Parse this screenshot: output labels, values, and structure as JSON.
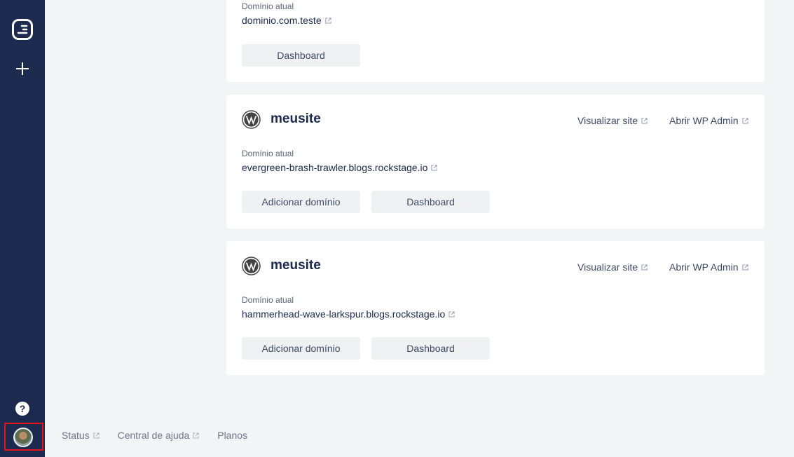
{
  "sidebar": {
    "logo_icon": "brand-logo-icon",
    "add_icon": "plus-icon",
    "help_label": "?",
    "avatar_icon": "user-avatar"
  },
  "cards": [
    {
      "domain_label": "Domínio atual",
      "domain_value": "dominio.com.teste",
      "dashboard_label": "Dashboard"
    },
    {
      "site_name": "meusite",
      "view_site": "Visualizar site",
      "open_admin": "Abrir WP Admin",
      "domain_label": "Domínio atual",
      "domain_value": "evergreen-brash-trawler.blogs.rockstage.io",
      "add_domain": "Adicionar domínio",
      "dashboard_label": "Dashboard"
    },
    {
      "site_name": "meusite",
      "view_site": "Visualizar site",
      "open_admin": "Abrir WP Admin",
      "domain_label": "Domínio atual",
      "domain_value": "hammerhead-wave-larkspur.blogs.rockstage.io",
      "add_domain": "Adicionar domínio",
      "dashboard_label": "Dashboard"
    }
  ],
  "footer": {
    "status": "Status",
    "help_center": "Central de ajuda",
    "plans": "Planos"
  },
  "colors": {
    "sidebar": "#1b2a4e",
    "background": "#f3f4f6",
    "highlight": "#e3131b"
  }
}
